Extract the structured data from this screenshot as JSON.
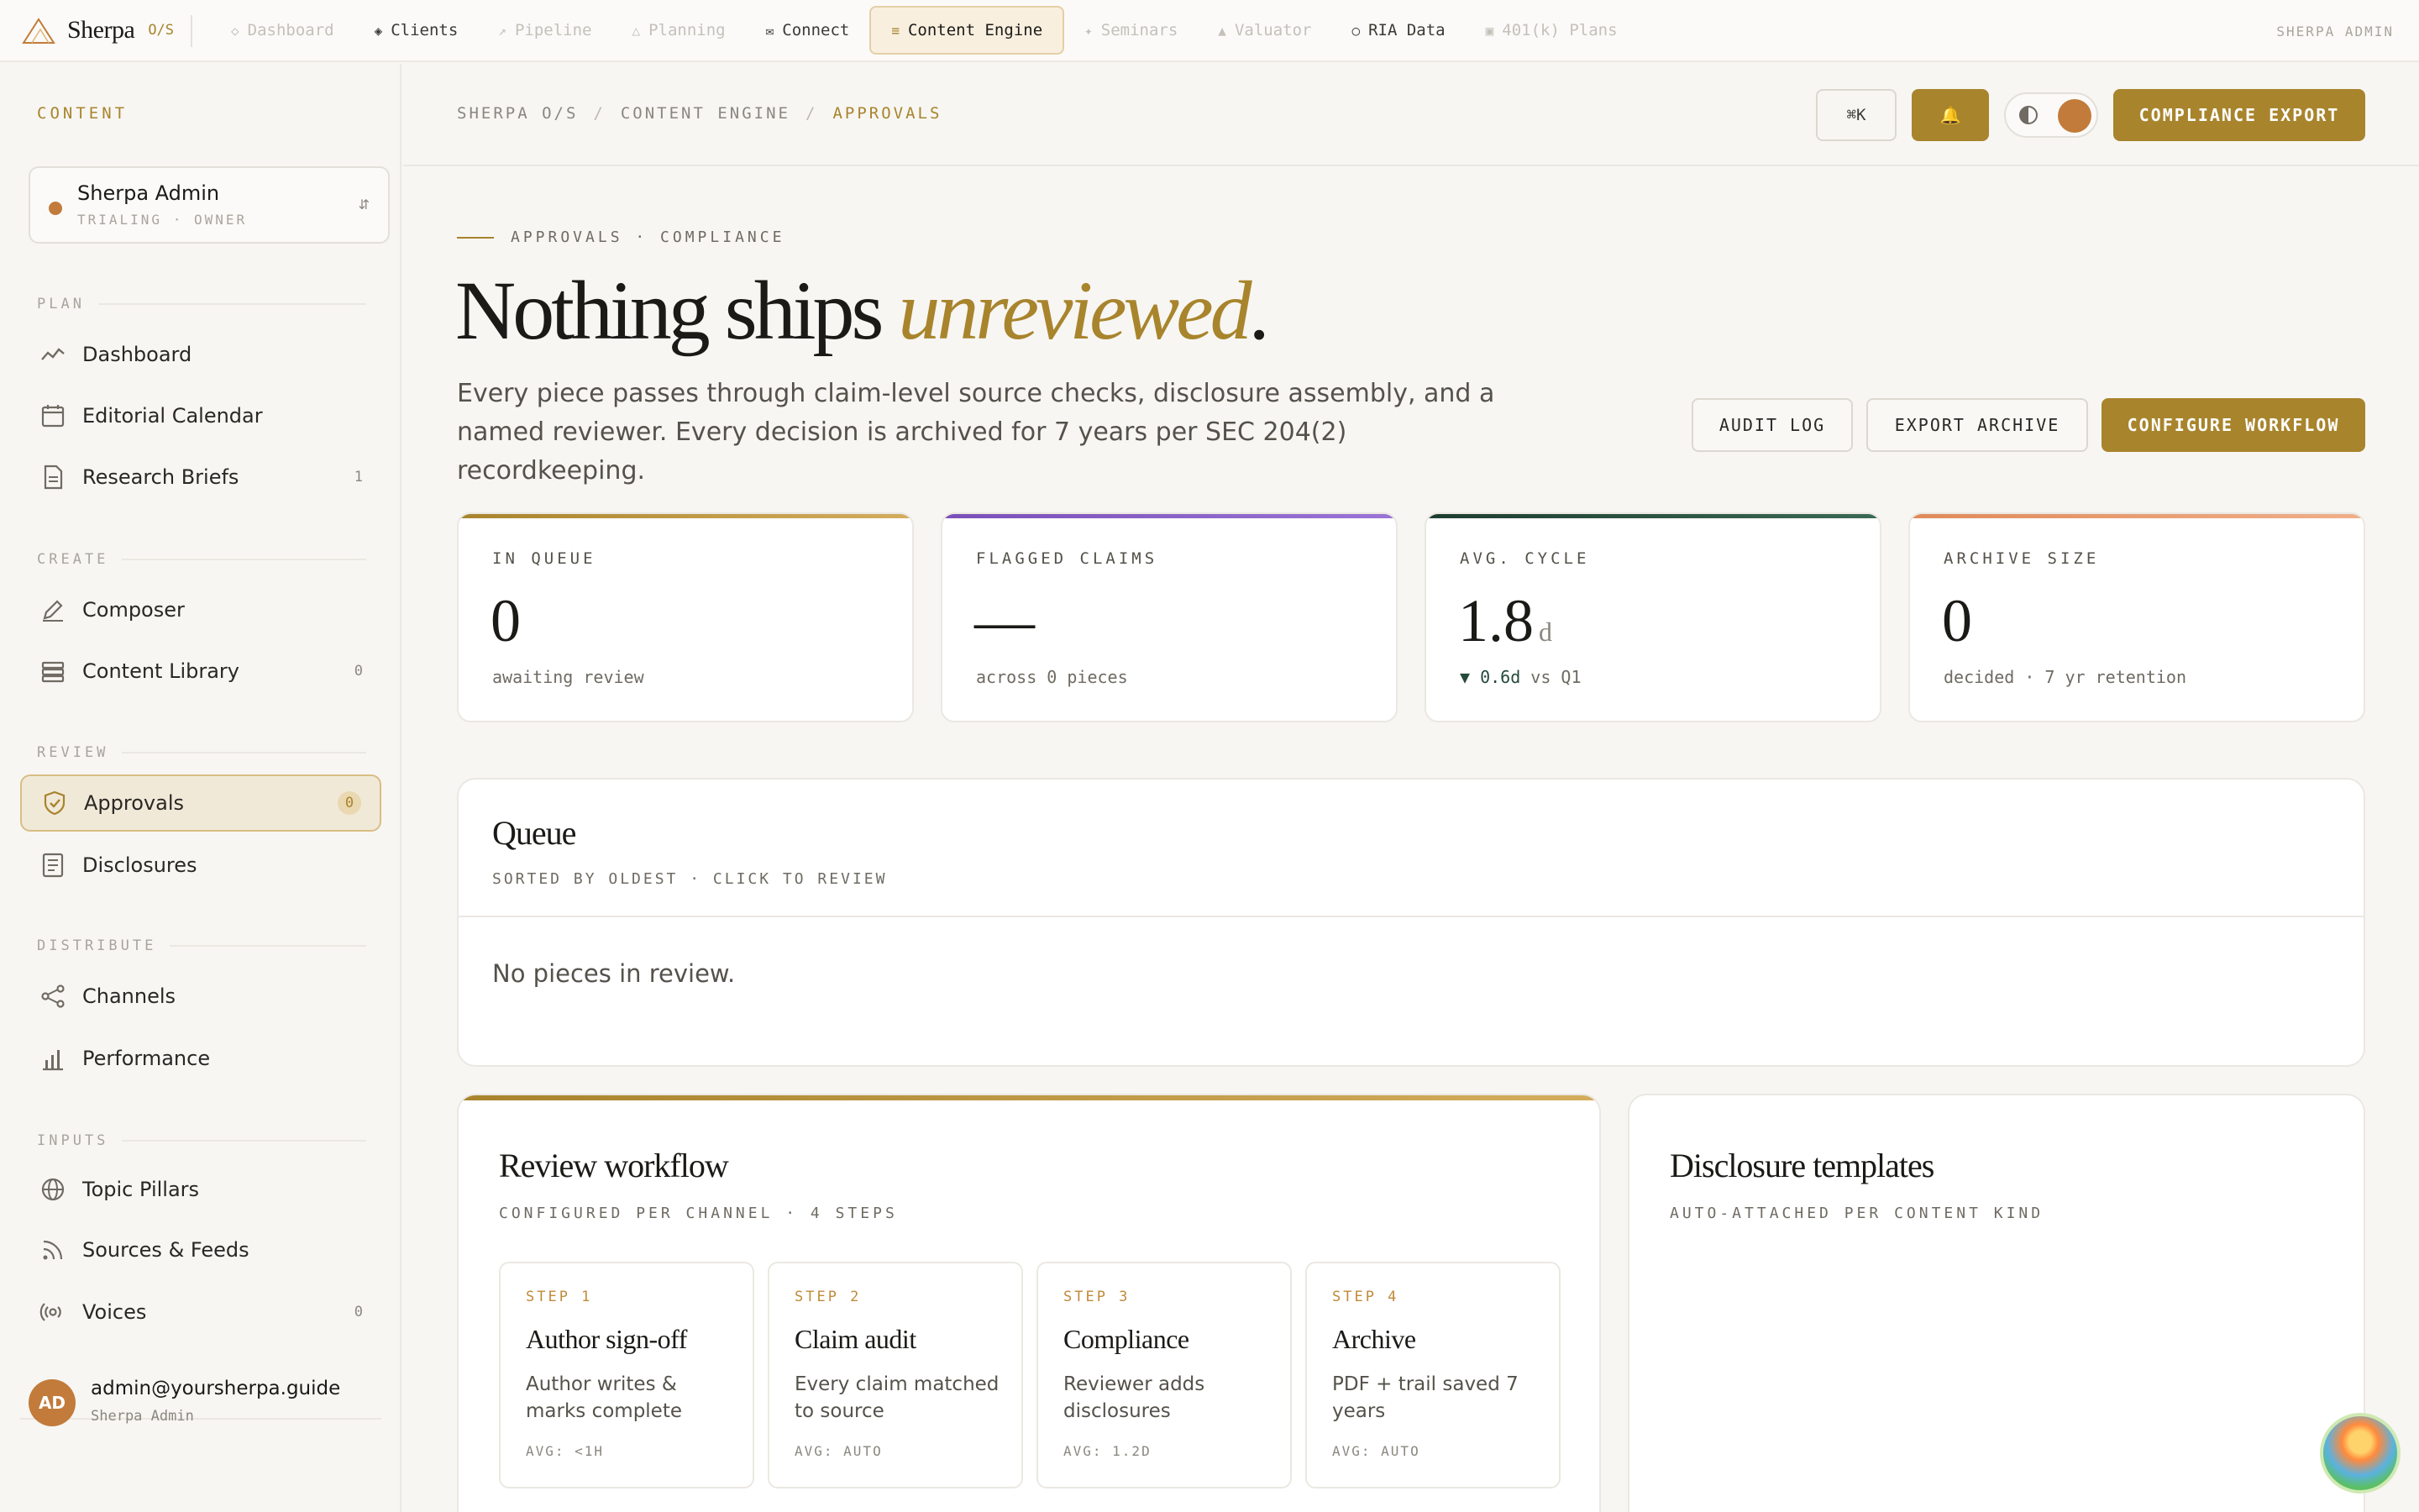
{
  "topnav": {
    "brand": "Sherpa",
    "brand_os": "O/S",
    "tabs": [
      {
        "label": "Dashboard",
        "icon": "◇"
      },
      {
        "label": "Clients",
        "icon": "◈"
      },
      {
        "label": "Pipeline",
        "icon": "↗"
      },
      {
        "label": "Planning",
        "icon": "△"
      },
      {
        "label": "Connect",
        "icon": "✉"
      },
      {
        "label": "Content Engine",
        "icon": "≡"
      },
      {
        "label": "Seminars",
        "icon": "✦"
      },
      {
        "label": "Valuator",
        "icon": "▲"
      },
      {
        "label": "RIA Data",
        "icon": "○"
      },
      {
        "label": "401(k) Plans",
        "icon": "▣"
      }
    ],
    "user": "SHERPA ADMIN"
  },
  "sidebar": {
    "title": "CONTENT",
    "workspace": {
      "name": "Sherpa Admin",
      "sub": "TRIALING · OWNER",
      "switch": "⇵"
    },
    "sections": {
      "plan": "PLAN",
      "create": "CREATE",
      "review": "REVIEW",
      "distribute": "DISTRIBUTE",
      "inputs": "INPUTS"
    },
    "items": {
      "dashboard": {
        "label": "Dashboard"
      },
      "calendar": {
        "label": "Editorial Calendar"
      },
      "briefs": {
        "label": "Research Briefs",
        "count": "1"
      },
      "composer": {
        "label": "Composer"
      },
      "library": {
        "label": "Content Library",
        "count": "0"
      },
      "approvals": {
        "label": "Approvals",
        "count": "0"
      },
      "disclosures": {
        "label": "Disclosures"
      },
      "channels": {
        "label": "Channels"
      },
      "performance": {
        "label": "Performance"
      },
      "pillars": {
        "label": "Topic Pillars"
      },
      "sources": {
        "label": "Sources & Feeds"
      },
      "voices": {
        "label": "Voices",
        "count": "0"
      }
    },
    "user": {
      "initials": "AD",
      "email": "admin@yoursherpa.guide",
      "role": "Sherpa Admin"
    }
  },
  "header": {
    "breadcrumb": [
      "SHERPA O/S",
      "CONTENT ENGINE",
      "APPROVALS"
    ],
    "kbd": "⌘K",
    "bell": "🔔",
    "export_label": "COMPLIANCE EXPORT"
  },
  "hero": {
    "eyebrow": "APPROVALS · COMPLIANCE",
    "headline_a": "Nothing ships ",
    "headline_em": "unreviewed",
    "headline_b": ".",
    "lede": "Every piece passes through claim-level source checks, disclosure assembly, and a named reviewer. Every decision is archived for 7 years per SEC 204(2) recordkeeping.",
    "buttons": {
      "audit": "AUDIT LOG",
      "archive": "EXPORT ARCHIVE",
      "configure": "CONFIGURE WORKFLOW"
    }
  },
  "stats": [
    {
      "label": "IN QUEUE",
      "value": "0",
      "unit": "",
      "note": "awaiting review",
      "accent": "#c9a24e"
    },
    {
      "label": "FLAGGED CLAIMS",
      "value": "—",
      "unit": "",
      "note": "across 0 pieces",
      "accent": "#7a4fb8"
    },
    {
      "label": "AVG. CYCLE",
      "value": "1.8",
      "unit": "d",
      "note_delta": "▼ 0.6d",
      "note": "vs Q1",
      "accent": "#244a3a"
    },
    {
      "label": "ARCHIVE SIZE",
      "value": "0",
      "unit": "",
      "note": "decided · 7 yr retention",
      "accent": "#e08a5a"
    }
  ],
  "queue": {
    "title": "Queue",
    "sub": "SORTED BY OLDEST · CLICK TO REVIEW",
    "empty": "No pieces in review."
  },
  "workflow": {
    "title": "Review workflow",
    "sub": "CONFIGURED PER CHANNEL · 4 STEPS",
    "steps": [
      {
        "num": "STEP 1",
        "title": "Author sign-off",
        "desc": "Author writes & marks complete",
        "avg": "AVG: <1H"
      },
      {
        "num": "STEP 2",
        "title": "Claim audit",
        "desc": "Every claim matched to source",
        "avg": "AVG: AUTO"
      },
      {
        "num": "STEP 3",
        "title": "Compliance",
        "desc": "Reviewer adds disclosures",
        "avg": "AVG: 1.2D"
      },
      {
        "num": "STEP 4",
        "title": "Archive",
        "desc": "PDF + trail saved 7 years",
        "avg": "AVG: AUTO"
      }
    ]
  },
  "disclosures": {
    "title": "Disclosure templates",
    "sub": "AUTO-ATTACHED PER CONTENT KIND"
  },
  "colors": {
    "accent": "#a8842c",
    "brand_orange": "#c27b3a"
  }
}
